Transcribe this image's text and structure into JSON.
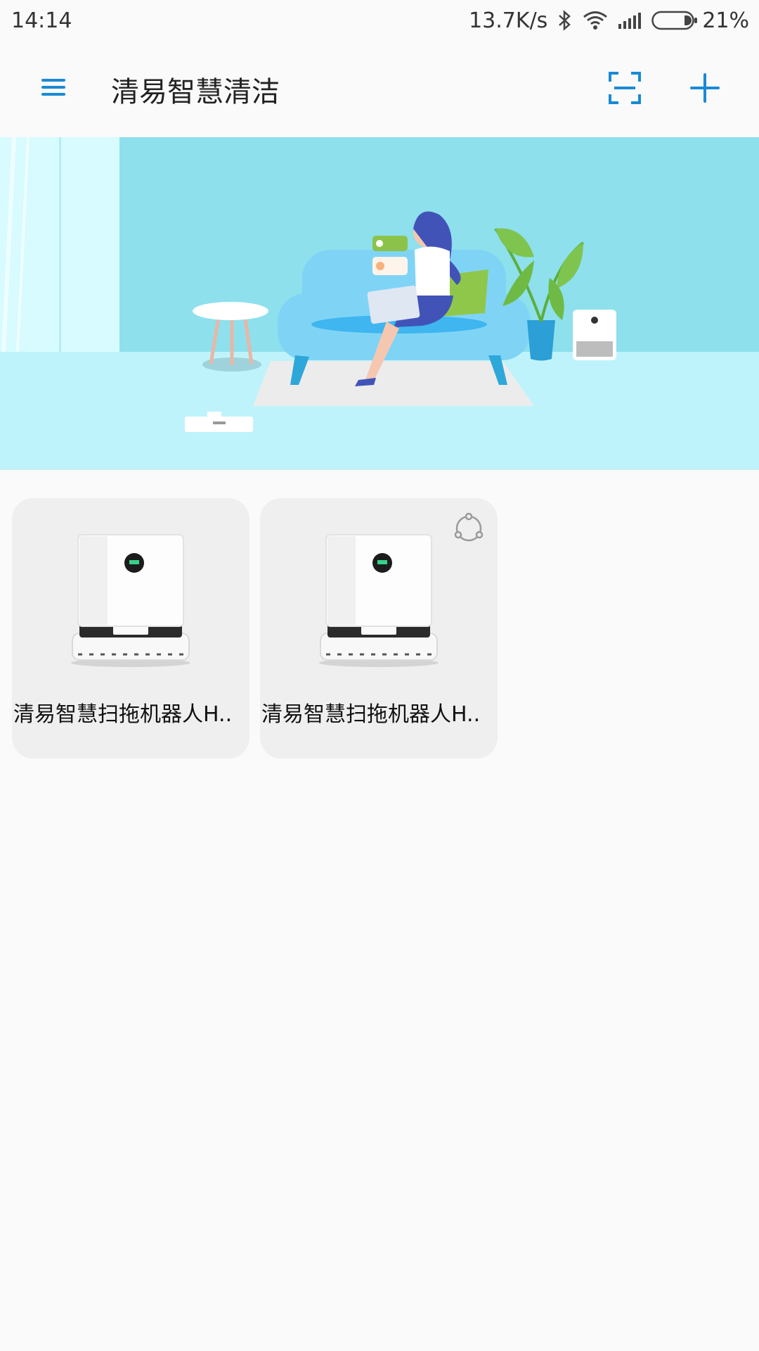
{
  "status_bar": {
    "time": "14:14",
    "net_speed": "13.7K/s",
    "battery_pct": "21%",
    "icons": [
      "bluetooth-icon",
      "wifi-icon",
      "signal-icon",
      "battery-icon"
    ]
  },
  "app_bar": {
    "title": "清易智慧清洁",
    "icons": [
      "menu-icon",
      "scan-icon",
      "add-icon"
    ],
    "accent_color": "#1a8ad4"
  },
  "devices": [
    {
      "name": "清易智慧扫拖机器人H..",
      "shared": false
    },
    {
      "name": "清易智慧扫拖机器人H..",
      "shared": true
    }
  ]
}
